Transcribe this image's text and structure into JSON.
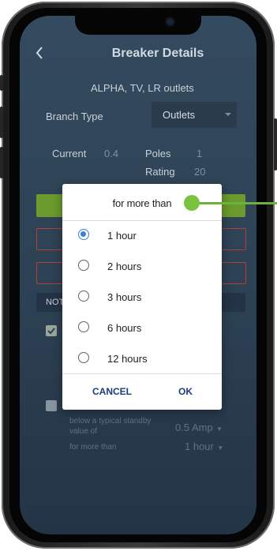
{
  "header": {
    "title": "Breaker Details"
  },
  "breaker": {
    "name": "ALPHA, TV, LR outlets",
    "branch_type_label": "Branch Type",
    "branch_type_value": "Outlets",
    "current_label": "Current",
    "current_value": "0.4",
    "poles_label": "Poles",
    "poles_value": "1",
    "rating_label": "Rating",
    "rating_value": "20"
  },
  "notifications": {
    "section_label_partial": "NOT",
    "standby_text_line1": "below a typical standby",
    "standby_text_line2": "value of",
    "standby_value": "0.5 Amp",
    "duration_label": "for more than",
    "duration_value": "1 hour"
  },
  "dialog": {
    "title": "for more than",
    "options": [
      {
        "label": "1 hour",
        "selected": true
      },
      {
        "label": "2 hours",
        "selected": false
      },
      {
        "label": "3 hours",
        "selected": false
      },
      {
        "label": "6 hours",
        "selected": false
      },
      {
        "label": "12 hours",
        "selected": false
      }
    ],
    "cancel_label": "CANCEL",
    "ok_label": "OK"
  },
  "colors": {
    "accent_green": "#7cc242",
    "radio_selected": "#3d7ed8",
    "button_text": "#1a3d7c",
    "error_border": "#b1403a"
  }
}
